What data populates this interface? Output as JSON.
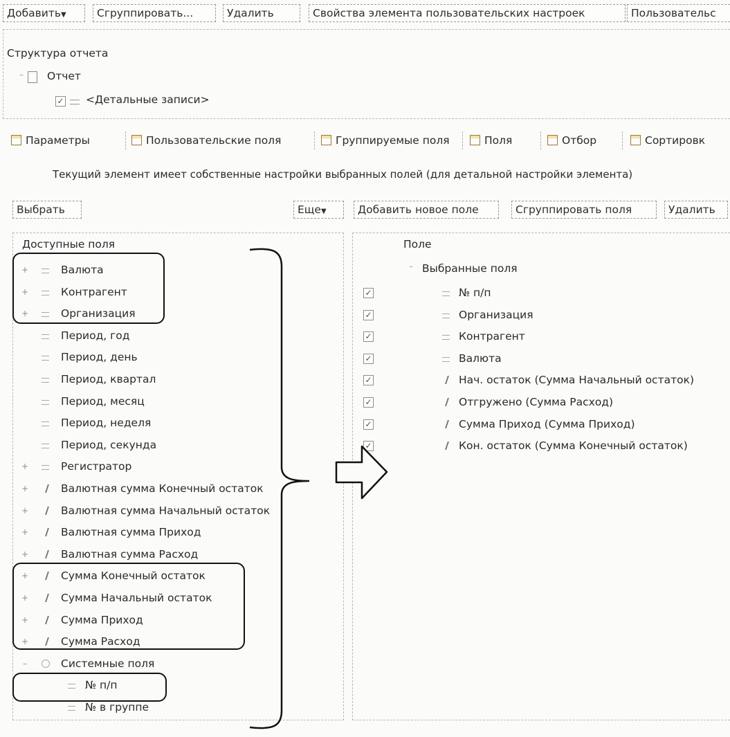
{
  "toolbar": {
    "add": "Добавить",
    "group": "Сгруппировать...",
    "delete": "Удалить",
    "item_props": "Свойства элемента пользовательских настроек",
    "user": "Пользовательс"
  },
  "structure": {
    "title": "Структура отчета",
    "report": "Отчет",
    "detail": "<Детальные записи>"
  },
  "tabs": {
    "params": "Параметры",
    "user_fields": "Пользовательские поля",
    "group_fields": "Группируемые поля",
    "fields": "Поля",
    "filter": "Отбор",
    "sort": "Сортировк"
  },
  "info_text": "Текущий элемент имеет собственные настройки выбранных полей (для детальной настройки элемента)",
  "left_toolbar": {
    "select": "Выбрать",
    "more": "Еще"
  },
  "right_toolbar": {
    "add_new": "Добавить новое поле",
    "group_fields": "Сгруппировать поля",
    "delete": "Удалить"
  },
  "available": {
    "header": "Доступные поля",
    "items": [
      "Валюта",
      "Контрагент",
      "Организация",
      "Период, год",
      "Период, день",
      "Период, квартал",
      "Период, месяц",
      "Период, неделя",
      "Период, секунда",
      "Регистратор",
      "Валютная сумма Конечный остаток",
      "Валютная сумма Начальный остаток",
      "Валютная сумма Приход",
      "Валютная сумма Расход",
      "Сумма Конечный остаток",
      "Сумма Начальный остаток",
      "Сумма Приход",
      "Сумма Расход",
      "Системные поля",
      "№ п/п",
      "№ в группе"
    ]
  },
  "selected": {
    "header": "Поле",
    "group": "Выбранные поля",
    "items": [
      "№ п/п",
      "Организация",
      "Контрагент",
      "Валюта",
      "Нач. остаток (Сумма Начальный остаток)",
      "Отгружено (Сумма Расход)",
      "Сумма Приход (Сумма Приход)",
      "Кон. остаток (Сумма Конечный остаток)"
    ]
  },
  "colors": {
    "annotation": "#111111",
    "tab_icon": "#f3e1a8"
  }
}
